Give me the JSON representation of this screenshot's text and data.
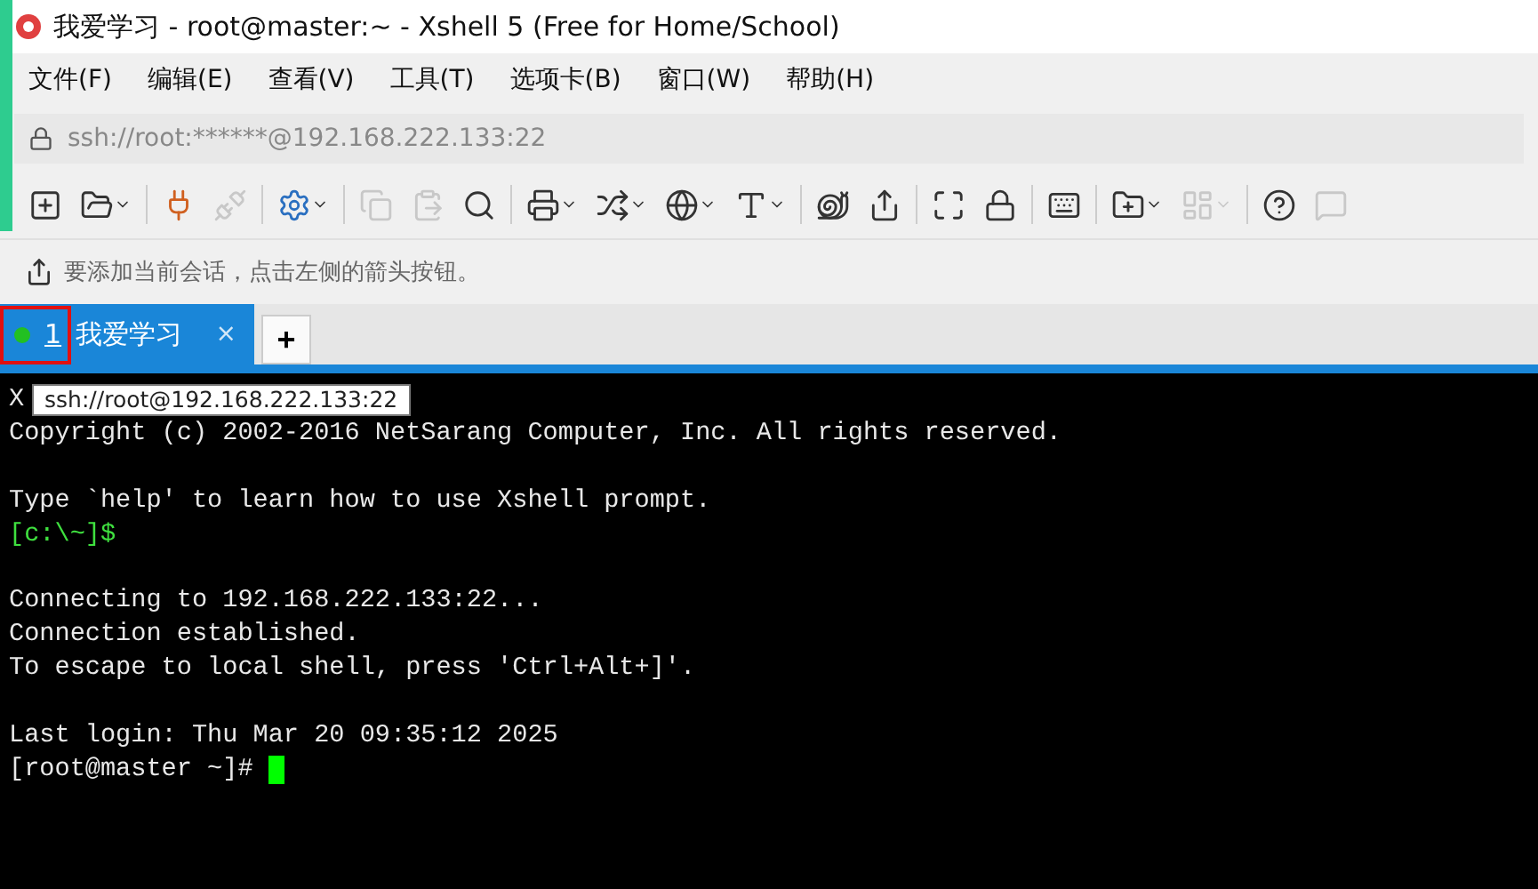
{
  "window": {
    "title": "我爱学习 - root@master:~ - Xshell 5 (Free for Home/School)"
  },
  "menu": [
    "文件(F)",
    "编辑(E)",
    "查看(V)",
    "工具(T)",
    "选项卡(B)",
    "窗口(W)",
    "帮助(H)"
  ],
  "address": "ssh://root:******@192.168.222.133:22",
  "hint": "要添加当前会话，点击左侧的箭头按钮。",
  "tabs": [
    {
      "number": "1",
      "label": "我爱学习",
      "selected": true,
      "connected": true,
      "close": "×"
    }
  ],
  "new_tab": "+",
  "tooltip": "ssh://root@192.168.222.133:22",
  "terminal": [
    {
      "kind": "text",
      "text": "X"
    },
    {
      "kind": "text",
      "text": "Copyright (c) 2002-2016 NetSarang Computer, Inc. All rights reserved."
    },
    {
      "kind": "blank"
    },
    {
      "kind": "text",
      "text": "Type `help' to learn how to use Xshell prompt."
    },
    {
      "kind": "prompt",
      "text": "[c:\\~]$"
    },
    {
      "kind": "blank"
    },
    {
      "kind": "text",
      "text": "Connecting to 192.168.222.133:22..."
    },
    {
      "kind": "text",
      "text": "Connection established."
    },
    {
      "kind": "text",
      "text": "To escape to local shell, press 'Ctrl+Alt+]'."
    },
    {
      "kind": "blank"
    },
    {
      "kind": "text",
      "text": "Last login: Thu Mar 20 09:35:12 2025"
    },
    {
      "kind": "cursor",
      "text": "[root@master ~]# "
    }
  ]
}
